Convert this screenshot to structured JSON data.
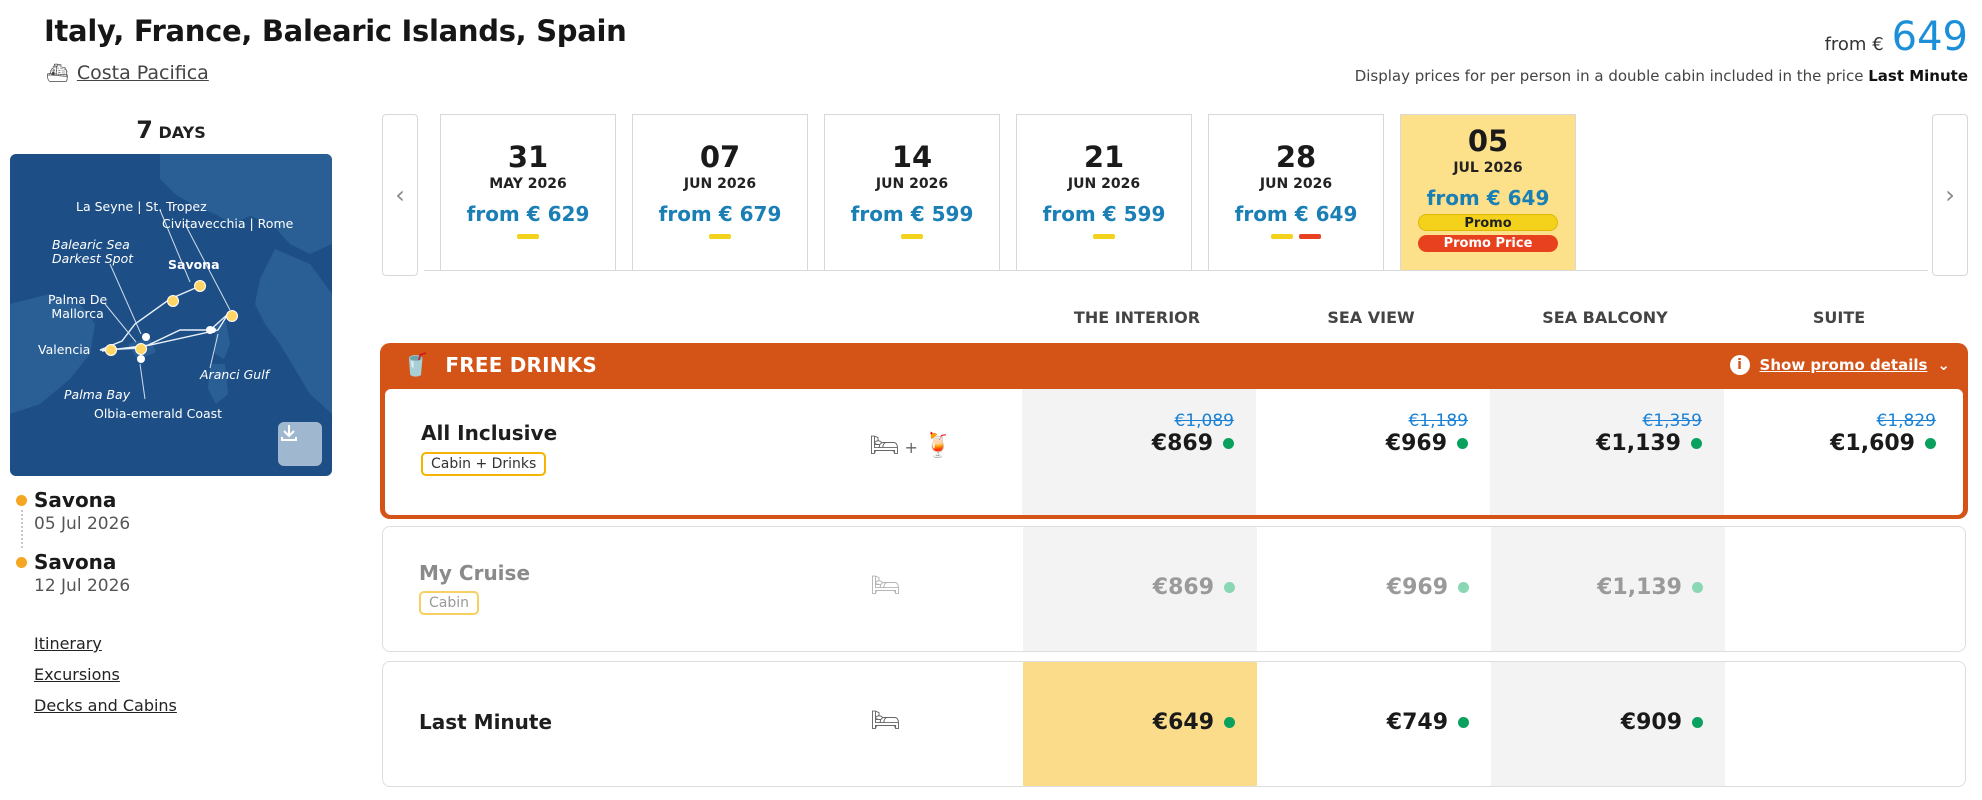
{
  "header": {
    "title": "Italy, France, Balearic Islands, Spain",
    "ship": "Costa Pacifica",
    "from_label": "from €",
    "from_value": "649",
    "display_note": "Display prices for per person in a double cabin included in the price",
    "display_note_bold": "Last Minute"
  },
  "cruise": {
    "days_num": "7",
    "days_unit": "DAYS"
  },
  "map_labels": {
    "la_seyne": "La Seyne | St. Tropez",
    "civitavecchia": "Civitavecchia | Rome",
    "balearic": "Balearic Sea\nDarkest Spot",
    "savona": "Savona",
    "palma_mallorca": "Palma De\nMallorca",
    "valencia": "Valencia",
    "aranci": "Aranci Gulf",
    "palma_bay": "Palma Bay",
    "olbia": "Olbia-emerald Coast"
  },
  "stops": [
    {
      "port": "Savona",
      "date": "05 Jul 2026"
    },
    {
      "port": "Savona",
      "date": "12 Jul 2026"
    }
  ],
  "links": [
    "Itinerary",
    "Excursions",
    "Decks and Cabins"
  ],
  "dates": [
    {
      "day": "31",
      "month": "MAY 2026",
      "price": "from € 629"
    },
    {
      "day": "07",
      "month": "JUN 2026",
      "price": "from € 679"
    },
    {
      "day": "14",
      "month": "JUN 2026",
      "price": "from € 599"
    },
    {
      "day": "21",
      "month": "JUN 2026",
      "price": "from € 599"
    },
    {
      "day": "28",
      "month": "JUN 2026",
      "price": "from € 649"
    },
    {
      "day": "05",
      "month": "JUL 2026",
      "price": "from € 649",
      "badge1": "Promo",
      "badge2": "Promo Price"
    }
  ],
  "columns": [
    "THE INTERIOR",
    "SEA VIEW",
    "SEA BALCONY",
    "SUITE"
  ],
  "free_drinks": {
    "title": "FREE DRINKS",
    "promo_link": "Show promo details"
  },
  "fares": {
    "all_inclusive": {
      "name": "All Inclusive",
      "tag": "Cabin + Drinks",
      "prices": [
        {
          "old": "€1,089",
          "new": "€869"
        },
        {
          "old": "€1,189",
          "new": "€969"
        },
        {
          "old": "€1,359",
          "new": "€1,139"
        },
        {
          "old": "€1,829",
          "new": "€1,609"
        }
      ]
    },
    "my_cruise": {
      "name": "My Cruise",
      "tag": "Cabin",
      "prices": [
        {
          "new": "€869"
        },
        {
          "new": "€969"
        },
        {
          "new": "€1,139"
        }
      ]
    },
    "last_minute": {
      "name": "Last Minute",
      "prices": [
        {
          "new": "€649"
        },
        {
          "new": "€749"
        },
        {
          "new": "€909"
        }
      ]
    }
  },
  "colors": {
    "accent_orange": "#d45317",
    "price_blue": "#1a7fb5",
    "selected_date": "#fde08a",
    "available_green": "#0aa15f"
  }
}
